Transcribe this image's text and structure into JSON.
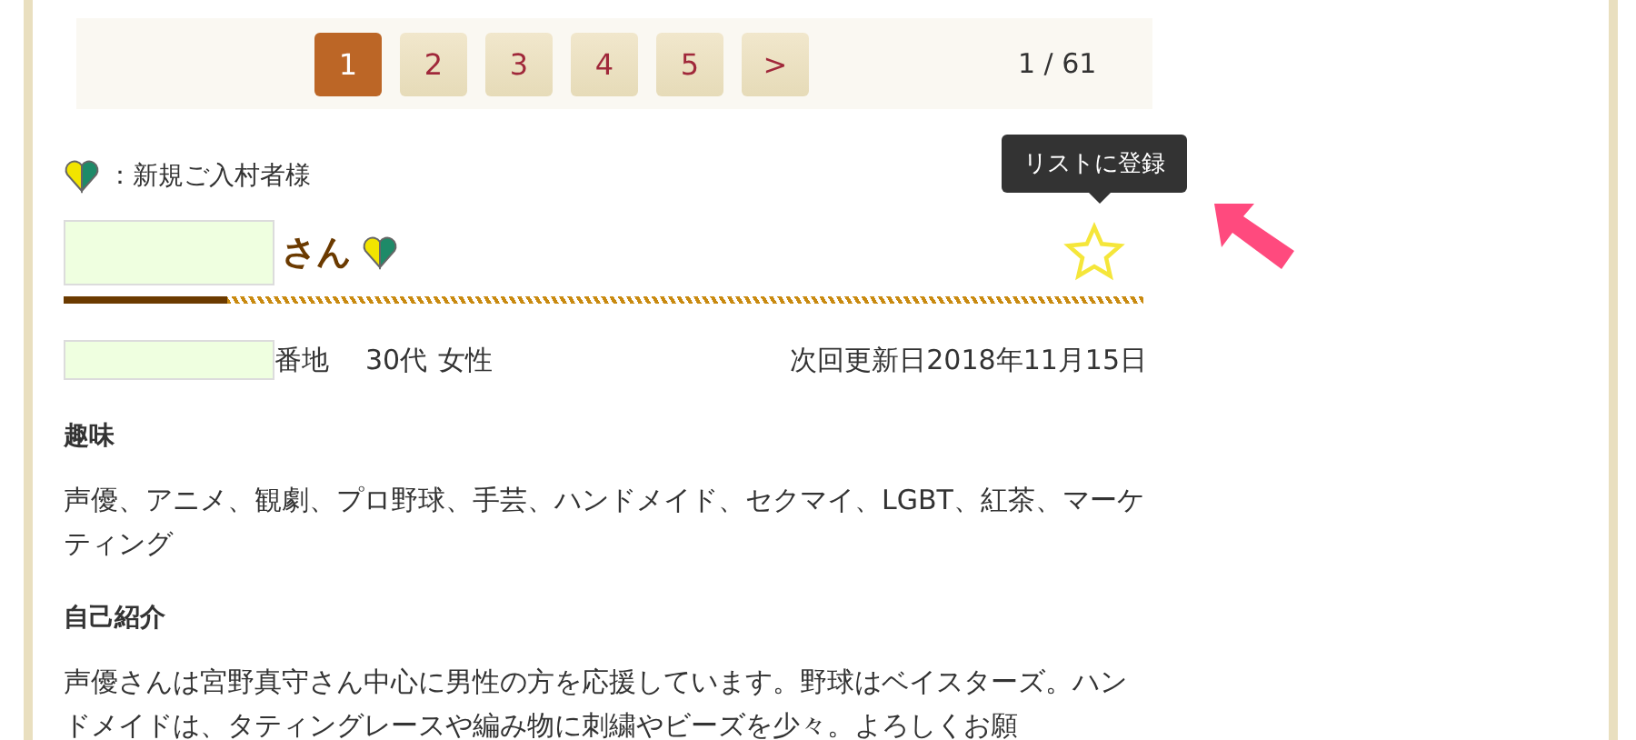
{
  "pagination": {
    "pages": [
      {
        "label": "1",
        "selected": true
      },
      {
        "label": "2",
        "selected": false
      },
      {
        "label": "3",
        "selected": false
      },
      {
        "label": "4",
        "selected": false
      },
      {
        "label": "5",
        "selected": false
      }
    ],
    "next": ">",
    "counter": "1 / 61"
  },
  "legend": {
    "text": "：新規ご入村者様"
  },
  "profile": {
    "name_suffix": "さん",
    "new_member": true,
    "favorite": false,
    "tooltip": "リストに登録",
    "address_suffix": "番地",
    "age": "30代",
    "gender": "女性",
    "next_update": "次回更新日2018年11月15日"
  },
  "sections": [
    {
      "heading": "趣味",
      "body": "声優、アニメ、観劇、プロ野球、手芸、ハンドメイド、セクマイ、LGBT、紅茶、マーケティング"
    },
    {
      "heading": "自己紹介",
      "body": "声優さんは宮野真守さん中心に男性の方を応援しています。野球はベイスターズ。ハンドメイドは、タティングレースや編み物に刺繍やビーズを少々。よろしくお願"
    }
  ]
}
